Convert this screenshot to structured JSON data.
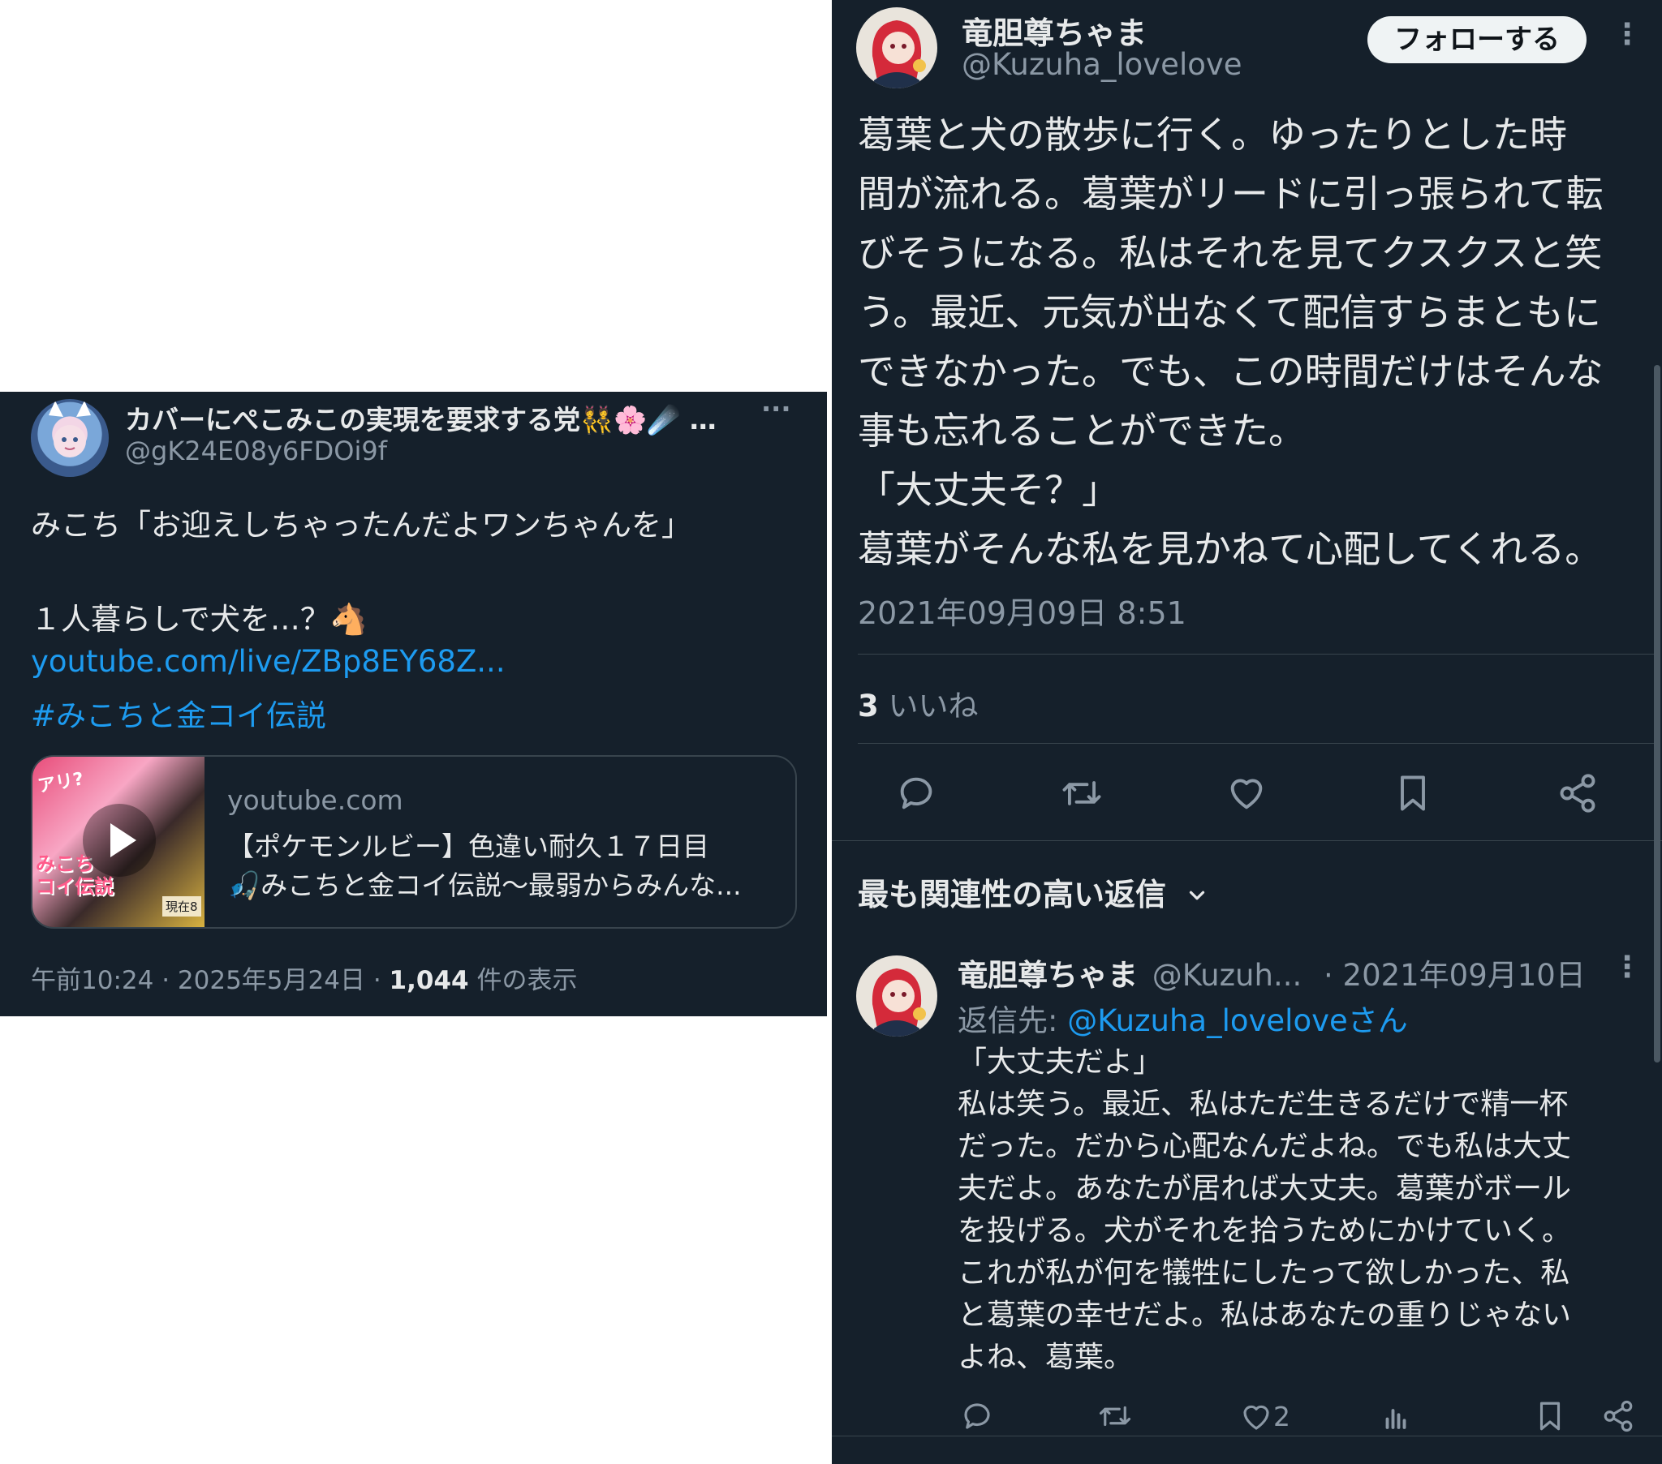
{
  "left_tweet": {
    "display_name": "カバーにぺこみこの実現を要求する党",
    "emoji_suffix": "👯🌸☄️ …",
    "handle": "@gK24E08y6FDOi9f",
    "more_menu": "···",
    "text_line1": "みこち「お迎えしちゃったんだよワンちゃんを」",
    "text_line2": "１人暮らしで犬を…？🐴",
    "link_url": "youtube.com/live/ZBp8EY68Z...",
    "hashtag": "#みこちと金コイ伝説",
    "card": {
      "domain": "youtube.com",
      "title_line1": "【ポケモンルビー】色違い耐久１７日目",
      "title_line2": "🎣みこちと金コイ伝説〜最弱からみんな...",
      "thumb_text_top": "アリ?",
      "thumb_text_main": "みこち\nコイ伝説",
      "thumb_badge": "現在8"
    },
    "meta_time": "午前10:24",
    "meta_sep1": " · ",
    "meta_date": "2025年5月24日",
    "meta_sep2": " · ",
    "meta_views_count": "1,044",
    "meta_views_label": " 件の表示"
  },
  "right_tweet": {
    "display_name": "竜胆尊ちゃま",
    "handle": "@Kuzuha_lovelove",
    "follow_button": "フォローする",
    "more_menu": "⋮",
    "body_lines": [
      "葛葉と犬の散歩に行く。ゆったりとした時",
      "間が流れる。葛葉がリードに引っ張られて転",
      "びそうになる。私はそれを見てクスクスと笑",
      "う。最近、元気が出なくて配信すらまともに",
      "できなかった。でも、この時間だけはそんな",
      "事も忘れることができた。",
      "「大丈夫そ？」",
      "葛葉がそんな私を見かねて心配してくれる。"
    ],
    "timestamp": "2021年09月09日 8:51",
    "likes_count": "3",
    "likes_label": " いいね",
    "sort_label": "最も関連性の高い返信",
    "sort_chevron": "⌄",
    "action_icons": [
      "reply-icon",
      "retweet-icon",
      "like-icon",
      "bookmark-icon",
      "share-icon"
    ]
  },
  "reply": {
    "display_name": "竜胆尊ちゃま",
    "handle": "@Kuzuh...",
    "date": "· 2021年09月10日",
    "more_menu": "⋮",
    "reply_to_label": "返信先: ",
    "reply_to_handle": "@Kuzuha_loveloveさん",
    "body_lines": [
      "「大丈夫だよ」",
      "私は笑う。最近、私はただ生きるだけで精一杯",
      "だった。だから心配なんだよね。でも私は大丈",
      "夫だよ。あなたが居れば大丈夫。葛葉がボール",
      "を投げる。犬がそれを拾うためにかけていく。",
      "これが私が何を犠牲にしたって欲しかった、私",
      "と葛葉の幸せだよ。私はあなたの重りじゃない",
      "よね、葛葉。"
    ],
    "like_count": "2",
    "action_icons": [
      "reply-icon",
      "retweet-icon",
      "like-icon",
      "views-icon",
      "bookmark-icon",
      "share-icon"
    ]
  },
  "colors": {
    "background": "#15202b",
    "text": "#e7e9ea",
    "muted": "#8b98a5",
    "link": "#1d9bf0",
    "divider": "#38444d",
    "follow_button_bg": "#eff3f4",
    "follow_button_text": "#0f1419"
  }
}
